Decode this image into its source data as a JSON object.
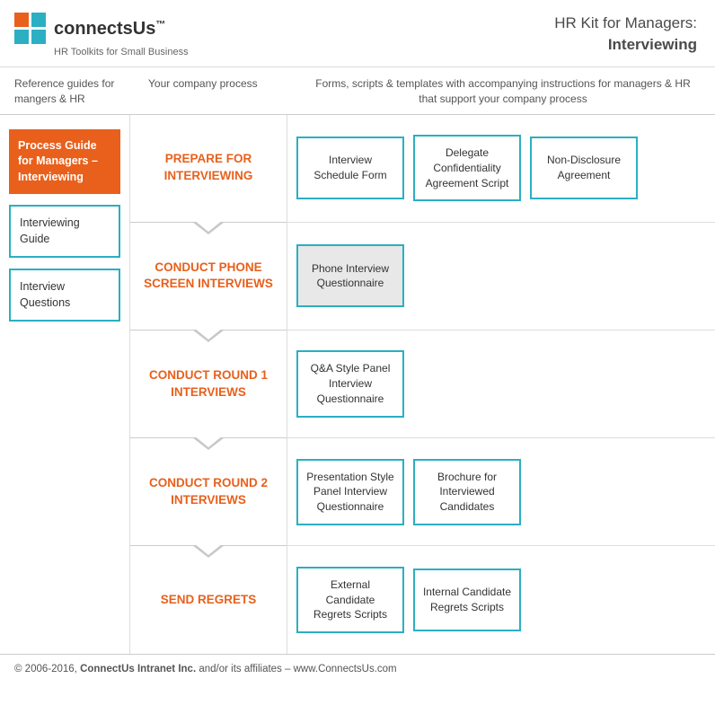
{
  "header": {
    "logo_text": "connectsUs",
    "logo_tm": "™",
    "logo_sub": "HR Toolkits for Small Business",
    "title_line1": "HR Kit for Managers:",
    "title_line2": "Interviewing"
  },
  "col_headers": {
    "ref": "Reference guides for mangers & HR",
    "process": "Your company process",
    "forms": "Forms, scripts & templates with accompanying instructions for managers & HR that support your company process"
  },
  "sidebar": {
    "items": [
      {
        "label": "Process Guide for Managers – Interviewing",
        "active": true
      },
      {
        "label": "Interviewing Guide",
        "active": false
      },
      {
        "label": "Interview Questions",
        "active": false
      }
    ]
  },
  "process_rows": [
    {
      "label": "PREPARE FOR INTERVIEWING"
    },
    {
      "label": "CONDUCT PHONE SCREEN INTERVIEWS"
    },
    {
      "label": "CONDUCT ROUND 1 INTERVIEWS"
    },
    {
      "label": "CONDUCT ROUND 2 INTERVIEWS"
    },
    {
      "label": "SEND REGRETS"
    }
  ],
  "forms_rows": [
    {
      "cards": [
        {
          "label": "Interview Schedule Form",
          "gray": false
        },
        {
          "label": "Delegate Confidentiality Agreement Script",
          "gray": false
        },
        {
          "label": "Non-Disclosure Agreement",
          "gray": false
        }
      ]
    },
    {
      "cards": [
        {
          "label": "Phone Interview Questionnaire",
          "gray": true
        }
      ]
    },
    {
      "cards": [
        {
          "label": "Q&A Style Panel Interview Questionnaire",
          "gray": false
        }
      ]
    },
    {
      "cards": [
        {
          "label": "Presentation Style Panel Interview Questionnaire",
          "gray": false
        },
        {
          "label": "Brochure for Interviewed Candidates",
          "gray": false
        }
      ]
    },
    {
      "cards": [
        {
          "label": "External Candidate Regrets Scripts",
          "gray": false
        },
        {
          "label": "Internal Candidate Regrets Scripts",
          "gray": false
        }
      ]
    }
  ],
  "footer": {
    "text": "© 2006-2016, ConnectUs Intranet Inc. and/or its affiliates – www.ConnectsUs.com",
    "bold_part": "ConnectUs Intranet Inc."
  }
}
